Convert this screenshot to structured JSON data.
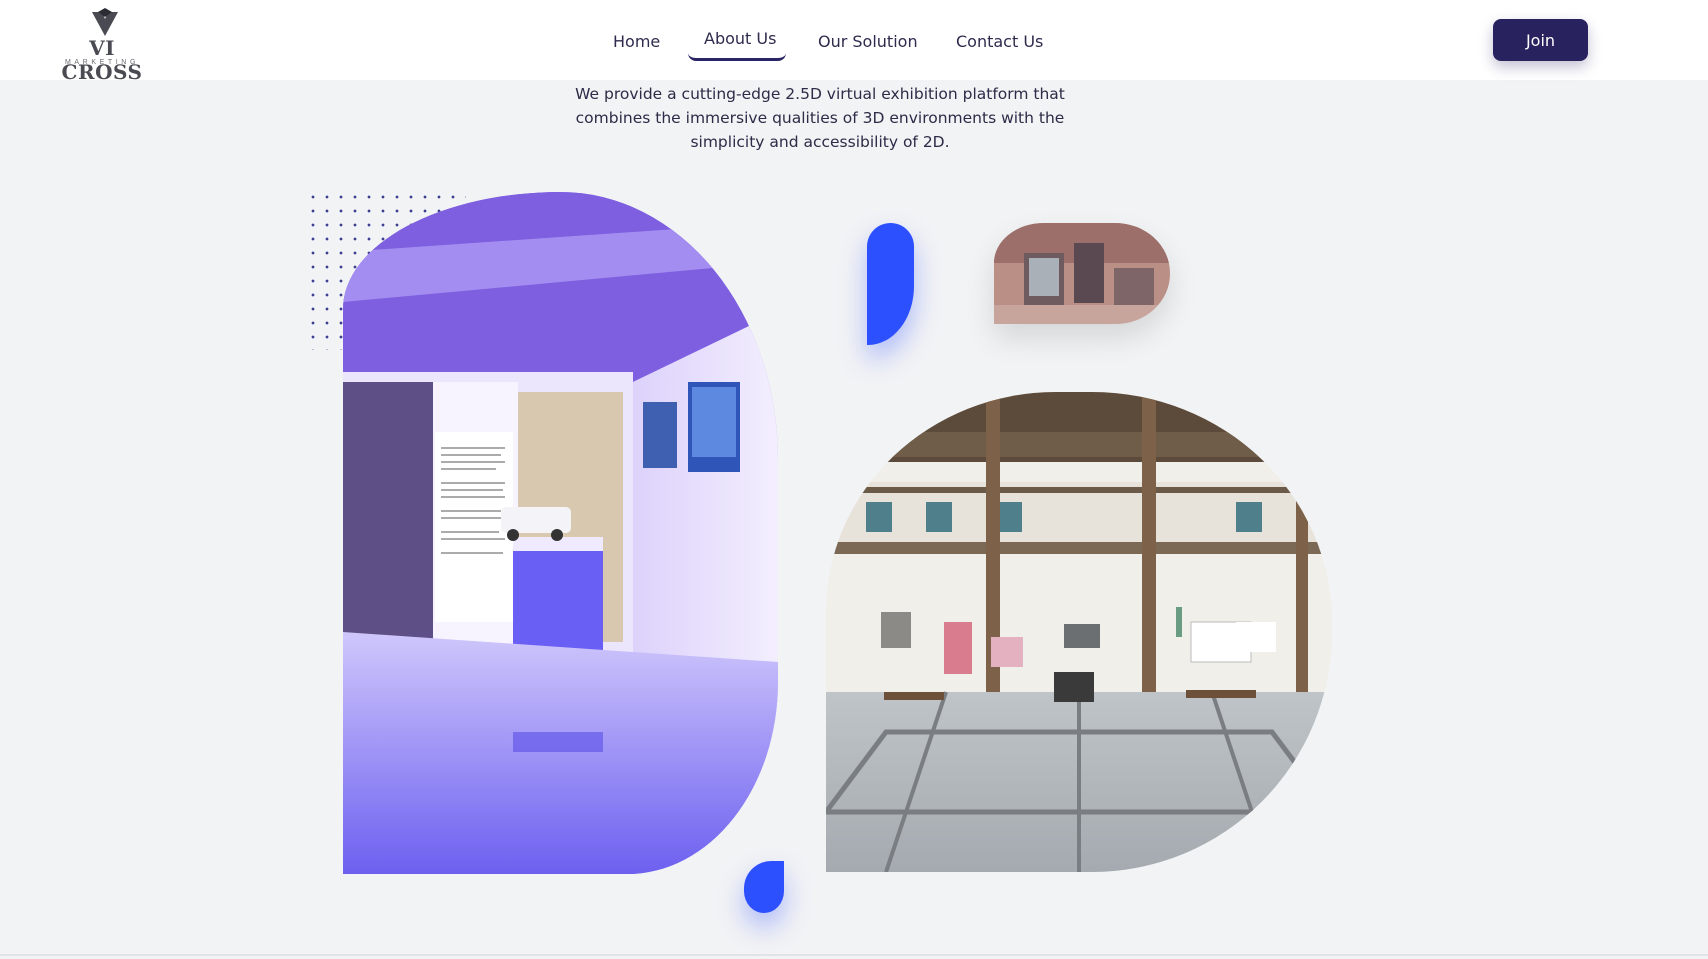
{
  "brand": {
    "name": "VI CROSS",
    "tagline": "MARKETING"
  },
  "nav": {
    "items": [
      {
        "label": "Home"
      },
      {
        "label": "About Us",
        "active": true
      },
      {
        "label": "Our Solution"
      },
      {
        "label": "Contact Us"
      }
    ]
  },
  "header": {
    "join_label": "Join"
  },
  "intro": {
    "text": "We provide a cutting-edge 2.5D virtual exhibition platform that combines the immersive qualities of 3D environments with the simplicity and accessibility of 2D."
  },
  "colors": {
    "primary": "#28225e",
    "accent": "#2d50ff",
    "background": "#f2f3f5"
  }
}
